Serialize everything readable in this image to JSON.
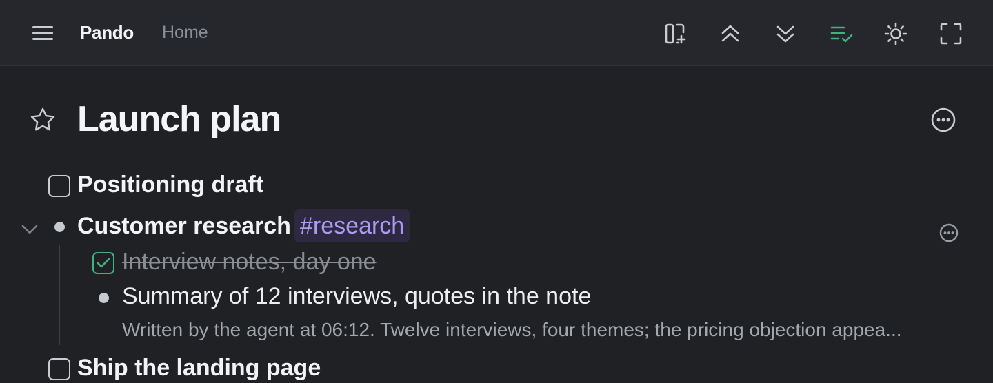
{
  "header": {
    "app_name": "Pando",
    "breadcrumb_home": "Home",
    "toolbar": {
      "icons": [
        "add-panel-icon",
        "collapse-all-icon",
        "expand-all-icon",
        "show-completed-icon",
        "theme-toggle-icon",
        "fullscreen-icon"
      ],
      "active_color": "#3fb37f"
    }
  },
  "page": {
    "title": "Launch plan",
    "favorite": false
  },
  "items": [
    {
      "text": "Positioning draft",
      "kind": "todo",
      "checked": false
    },
    {
      "text": "Customer research",
      "kind": "bullet",
      "expanded": true,
      "tag": "#research",
      "children": [
        {
          "text": "Interview notes, day one",
          "kind": "todo",
          "checked": true
        },
        {
          "text": "Summary of 12 interviews, quotes in the note",
          "kind": "bullet",
          "note": "Written by the agent at 06:12. Twelve interviews, four themes; the pricing objection appea..."
        }
      ]
    },
    {
      "text": "Ship the landing page",
      "kind": "todo",
      "checked": false
    }
  ],
  "colors": {
    "background": "#1f2125",
    "tag_text": "#a99cf2",
    "tag_bg": "#2e2940",
    "checked": "#3fb37f"
  }
}
